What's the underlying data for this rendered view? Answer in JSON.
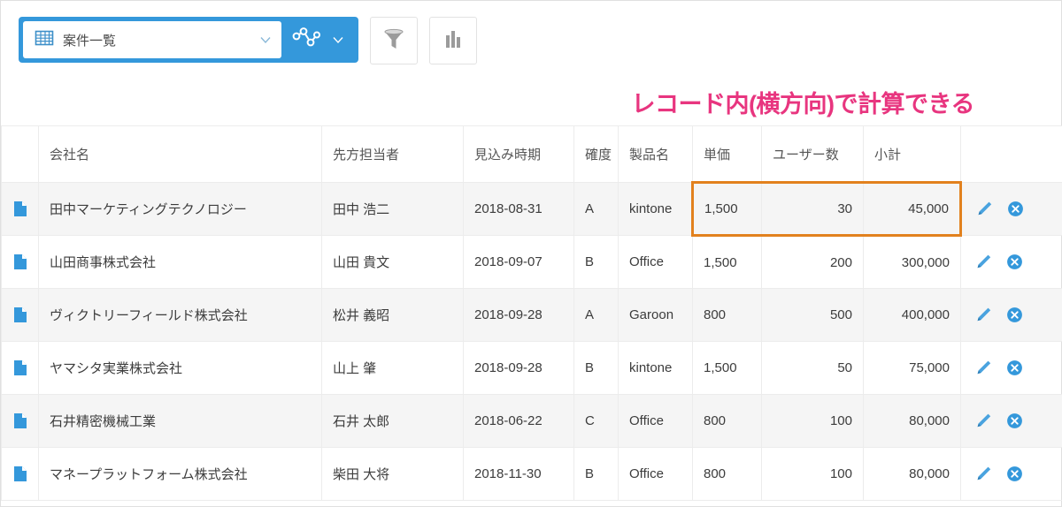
{
  "toolbar": {
    "view_selector": {
      "label": "案件一覧",
      "grid_icon": "grid-icon",
      "chevron_icon": "chevron-down-icon"
    },
    "graph_toggle": {
      "icon": "line-graph-icon",
      "chevron_icon": "chevron-down-icon"
    },
    "filter_button": {
      "icon": "funnel-filter-icon"
    },
    "chart_button": {
      "icon": "bar-chart-icon"
    }
  },
  "annotation": {
    "text": "レコード内(横方向)で計算できる",
    "color": "#e8357f"
  },
  "highlight": {
    "color": "#e2811e",
    "columns": [
      "単価",
      "ユーザー数",
      "小計"
    ],
    "row_index": 0
  },
  "table": {
    "columns": [
      {
        "key": "icon",
        "label": ""
      },
      {
        "key": "company",
        "label": "会社名"
      },
      {
        "key": "person",
        "label": "先方担当者"
      },
      {
        "key": "date",
        "label": "見込み時期"
      },
      {
        "key": "prob",
        "label": "確度"
      },
      {
        "key": "product",
        "label": "製品名"
      },
      {
        "key": "price",
        "label": "単価"
      },
      {
        "key": "users",
        "label": "ユーザー数"
      },
      {
        "key": "subtotal",
        "label": "小計"
      },
      {
        "key": "actions",
        "label": ""
      }
    ],
    "rows": [
      {
        "company": "田中マーケティングテクノロジー",
        "person": "田中 浩二",
        "date": "2018-08-31",
        "prob": "A",
        "product": "kintone",
        "price": "1,500",
        "users": "30",
        "subtotal": "45,000"
      },
      {
        "company": "山田商事株式会社",
        "person": "山田 貴文",
        "date": "2018-09-07",
        "prob": "B",
        "product": "Office",
        "price": "1,500",
        "users": "200",
        "subtotal": "300,000"
      },
      {
        "company": "ヴィクトリーフィールド株式会社",
        "person": "松井 義昭",
        "date": "2018-09-28",
        "prob": "A",
        "product": "Garoon",
        "price": "800",
        "users": "500",
        "subtotal": "400,000"
      },
      {
        "company": "ヤマシタ実業株式会社",
        "person": "山上 肇",
        "date": "2018-09-28",
        "prob": "B",
        "product": "kintone",
        "price": "1,500",
        "users": "50",
        "subtotal": "75,000"
      },
      {
        "company": "石井精密機械工業",
        "person": "石井 太郎",
        "date": "2018-06-22",
        "prob": "C",
        "product": "Office",
        "price": "800",
        "users": "100",
        "subtotal": "80,000"
      },
      {
        "company": "マネープラットフォーム株式会社",
        "person": "柴田 大将",
        "date": "2018-11-30",
        "prob": "B",
        "product": "Office",
        "price": "800",
        "users": "100",
        "subtotal": "80,000"
      }
    ],
    "row_icon": "record-document-icon",
    "row_actions": [
      {
        "name": "edit-record-icon"
      },
      {
        "name": "delete-record-icon"
      }
    ]
  }
}
